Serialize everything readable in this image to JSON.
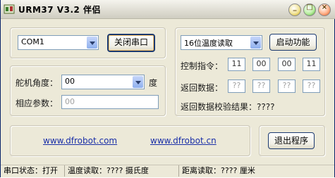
{
  "window": {
    "title": "URM37 V3.2 伴侣",
    "min_glyph": "_",
    "max_glyph": "□",
    "close_glyph": "×"
  },
  "serial": {
    "port_value": "COM1",
    "toggle_button": "关闭串口"
  },
  "servo": {
    "angle_label": "舵机角度：",
    "angle_value": "00",
    "degree_unit": "度",
    "response_label": "相应参数：",
    "response_value": "00"
  },
  "sensor": {
    "mode_value": "16位温度读取",
    "start_button": "启动功能",
    "command_label": "控制指令：",
    "commands": [
      "11",
      "00",
      "00",
      "11"
    ],
    "return_label": "返回数据：",
    "returns": [
      "??",
      "??",
      "??",
      "??"
    ],
    "checksum_label": "返回数据校验结果：????"
  },
  "links": {
    "link1": "www.dfrobot.com",
    "link2": "www.dfrobot.cn"
  },
  "exit_button": "退出程序",
  "status": {
    "serial_state": "串口状态：打开",
    "temperature": "温度读取：???? 摄氏度",
    "distance": "距离读取：???? 厘米"
  }
}
